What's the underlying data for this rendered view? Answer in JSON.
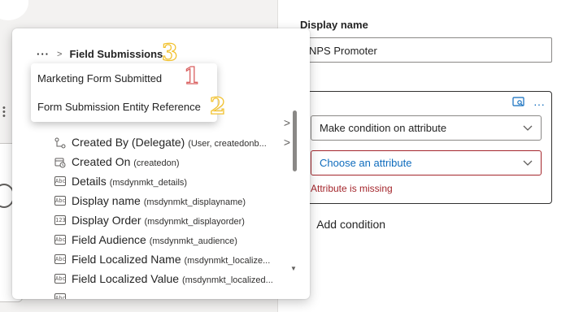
{
  "right_panel": {
    "display_name_label": "Display name",
    "display_name_value": "NPS Promoter",
    "condition_type_select": "Make condition on attribute",
    "attribute_select_placeholder": "Choose an attribute",
    "attribute_error": "Attribute is missing",
    "add_condition_label": "Add condition"
  },
  "flyout": {
    "breadcrumb_more": "···",
    "breadcrumb_current": "Field Submissions",
    "popup_items": [
      {
        "label": "Marketing Form Submitted"
      },
      {
        "label": "Form Submission Entity Reference"
      }
    ],
    "fields": [
      {
        "name": "Created By (Delegate)",
        "sub": "(User, createdonb...",
        "icon": "lookup-icon",
        "has_children": true
      },
      {
        "name": "Created On",
        "sub": "(createdon)",
        "icon": "calendar-clock-icon",
        "has_children": false
      },
      {
        "name": "Details",
        "sub": "(msdynmkt_details)",
        "icon": "text-field-icon",
        "has_children": false
      },
      {
        "name": "Display name",
        "sub": "(msdynmkt_displayname)",
        "icon": "text-field-icon",
        "has_children": false
      },
      {
        "name": "Display Order",
        "sub": "(msdynmkt_displayorder)",
        "icon": "number-field-icon",
        "has_children": false
      },
      {
        "name": "Field Audience",
        "sub": "(msdynmkt_audience)",
        "icon": "text-field-icon",
        "has_children": false
      },
      {
        "name": "Field Localized Name",
        "sub": "(msdynmkt_localize...",
        "icon": "text-field-icon",
        "has_children": false
      },
      {
        "name": "Field Localized Value",
        "sub": "(msdynmkt_localized...",
        "icon": "text-field-icon",
        "has_children": false
      }
    ]
  },
  "annotations": {
    "n1": "1",
    "n2": "2",
    "n3": "3",
    "colors": {
      "red": "#d96060",
      "yellow": "#f2c230"
    }
  },
  "icon_glyphs": {
    "text": "Abc",
    "number": "123"
  }
}
